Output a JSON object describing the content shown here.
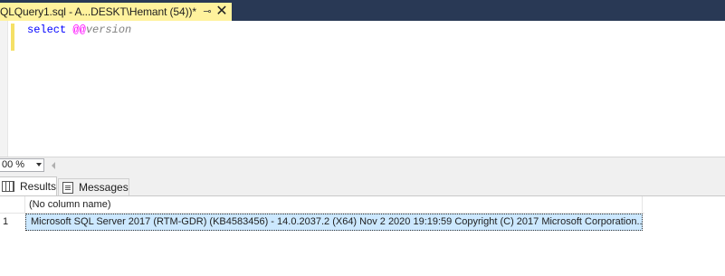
{
  "document_tab": {
    "title": "QLQuery1.sql - A...DESKT\\Hemant (54))*",
    "pin_glyph": "⊸",
    "close_glyph": "✕"
  },
  "editor": {
    "keyword": "select",
    "variable_prefix": "@@",
    "variable_name": "version",
    "colors": {
      "keyword": "#0000ff",
      "variable": "#ff00ff"
    }
  },
  "zoom": {
    "value": "00 %"
  },
  "results_tabs": [
    {
      "label": "Results",
      "icon": "grid-icon",
      "active": true
    },
    {
      "label": "Messages",
      "icon": "messages-icon",
      "active": false
    }
  ],
  "grid": {
    "columns": [
      "(No column name)"
    ],
    "rows": [
      {
        "row_number": "1",
        "cells": [
          "Microsoft SQL Server 2017 (RTM-GDR) (KB4583456) - 14.0.2037.2 (X64)   Nov  2 2020 19:19:59   Copyright (C) 2017 Microsoft Corporation..."
        ]
      }
    ]
  },
  "theme": {
    "tabstrip_bg": "#293955",
    "active_tab_bg": "#fff29d",
    "selection_bg": "#cce8ff"
  }
}
